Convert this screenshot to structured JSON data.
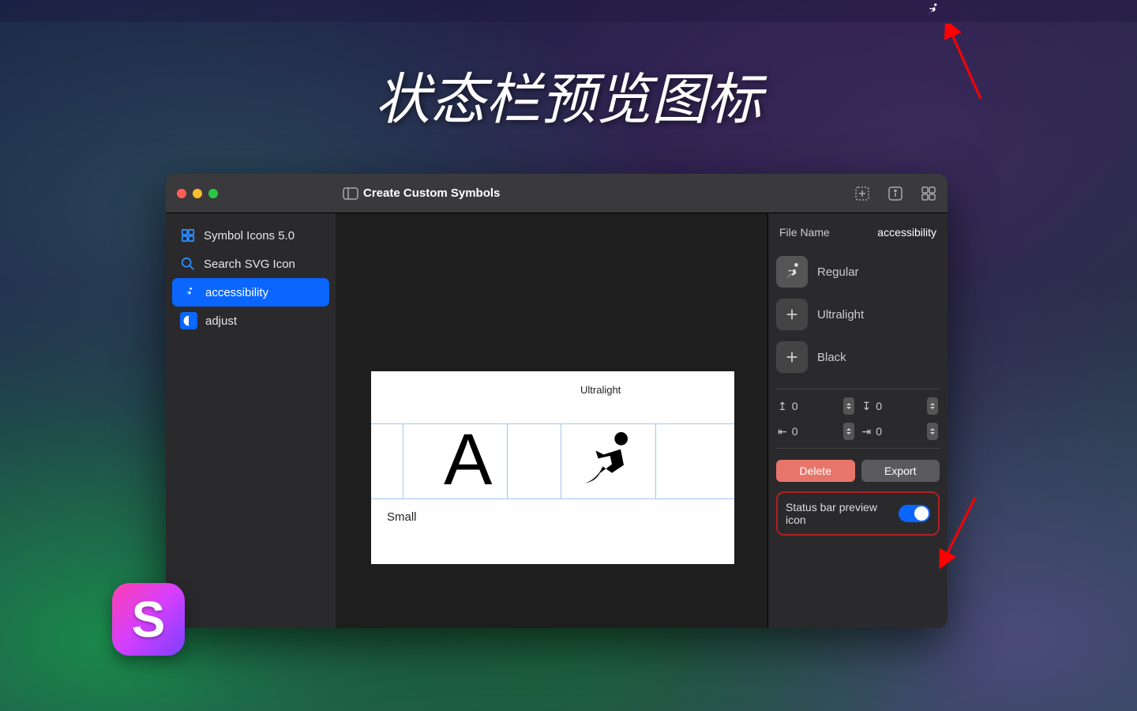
{
  "headline": "状态栏预览图标",
  "menubarIcon": "accessibility-icon",
  "window": {
    "title": "Create Custom Symbols",
    "sidebar": {
      "items": [
        {
          "icon": "grid-icon",
          "label": "Symbol Icons 5.0"
        },
        {
          "icon": "search-icon",
          "label": "Search SVG Icon"
        },
        {
          "icon": "accessibility-icon",
          "label": "accessibility",
          "selected": true
        },
        {
          "icon": "adjust-icon",
          "label": "adjust"
        }
      ]
    },
    "canvas": {
      "topLabel": "Ultralight",
      "bottomLabel": "Small",
      "referenceLetter": "A"
    },
    "inspector": {
      "fileNameLabel": "File Name",
      "fileName": "accessibility",
      "weights": [
        {
          "label": "Regular",
          "hasPreview": true
        },
        {
          "label": "Ultralight",
          "hasPreview": false
        },
        {
          "label": "Black",
          "hasPreview": false
        }
      ],
      "nudge": {
        "up": "0",
        "down": "0",
        "left": "0",
        "right": "0"
      },
      "deleteLabel": "Delete",
      "exportLabel": "Export",
      "toggleLabel": "Status bar preview icon",
      "toggleOn": true
    }
  },
  "dockLetter": "S"
}
